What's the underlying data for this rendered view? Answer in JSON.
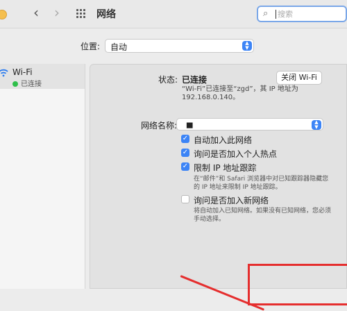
{
  "titlebar": {
    "title": "网络",
    "back_icon": "chevron-left-icon",
    "forward_icon": "chevron-right-icon",
    "grid_icon": "grid-icon"
  },
  "search": {
    "placeholder": "搜索",
    "icon": "search-icon"
  },
  "location": {
    "label": "位置:",
    "value": "自动"
  },
  "sidebar": {
    "items": [
      {
        "name": "Wi-Fi",
        "status": "已连接",
        "icon": "wifi-icon",
        "status_color": "#2fbf4a"
      }
    ]
  },
  "panel": {
    "status_label": "状态:",
    "status_value": "已连接",
    "toggle_button": "关闭 Wi-Fi",
    "status_description": "“Wi-Fi”已连接至“zgd”，其 IP 地址为 192.168.0.140。",
    "network_name_label": "网络名称:",
    "network_name_value": "▅",
    "options": [
      {
        "label": "自动加入此网络",
        "checked": true
      },
      {
        "label": "询问是否加入个人热点",
        "checked": true
      },
      {
        "label": "限制 IP 地址跟踪",
        "checked": true,
        "note": "在“邮件”和 Safari 浏览器中对已知跟踪器隐藏您的 IP 地址来限制 IP 地址跟踪。"
      },
      {
        "label": "询问是否加入新网络",
        "checked": false,
        "note": "将自动加入已知网络。如果没有已知网络，您必须手动选择。"
      }
    ]
  },
  "colors": {
    "accent": "#3c84f6",
    "annotation": "#e52e2e"
  }
}
